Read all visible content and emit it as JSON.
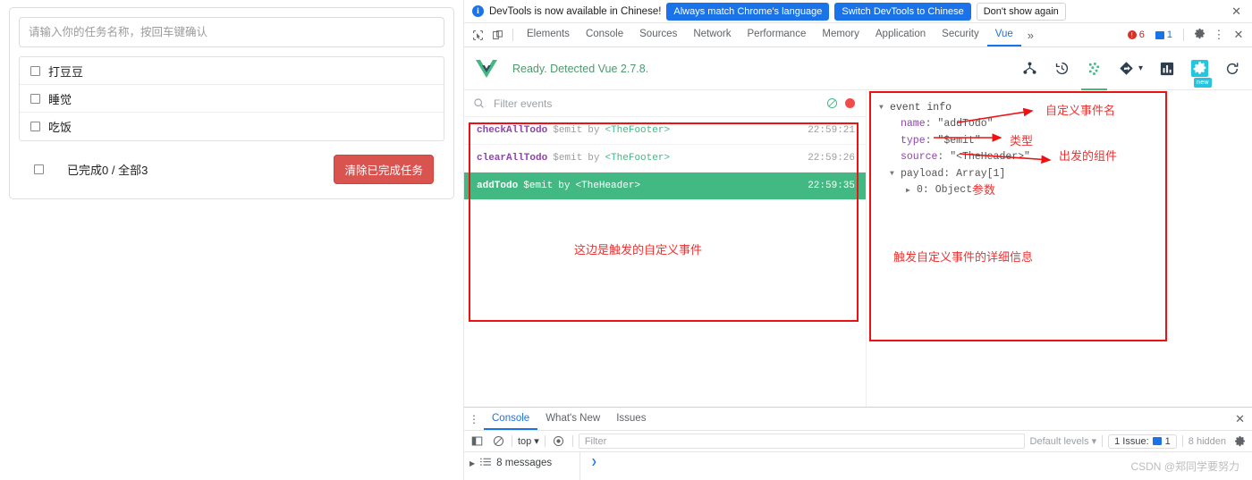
{
  "todo_app": {
    "input_placeholder": "请输入你的任务名称，按回车键确认",
    "input_value": "",
    "items": [
      {
        "label": "打豆豆",
        "checked": false
      },
      {
        "label": "睡觉",
        "checked": false
      },
      {
        "label": "吃饭",
        "checked": false
      }
    ],
    "footer": {
      "summary": "已完成0 / 全部3",
      "clear_button": "清除已完成任务",
      "clear_button_color": "#d9534f"
    }
  },
  "devtools": {
    "banner": {
      "message": "DevTools is now available in Chinese!",
      "primary_button": "Always match Chrome's language",
      "secondary_button": "Switch DevTools to Chinese",
      "tertiary_button": "Don't show again",
      "close": "✕",
      "accent_color": "#1a73e8"
    },
    "tabs": [
      "Elements",
      "Console",
      "Sources",
      "Network",
      "Performance",
      "Memory",
      "Application",
      "Security",
      "Vue"
    ],
    "active_tab": "Vue",
    "more_tabs": "»",
    "status": {
      "errors": "6",
      "messages": "1"
    }
  },
  "vue_panel": {
    "status_text": "Ready. Detected Vue 2.7.8.",
    "status_color": "#4a9a6e",
    "new_chip": "new",
    "toolbar_icons": [
      "component-tree-icon",
      "timeline-icon",
      "events-icon",
      "routes-icon",
      "performance-icon",
      "settings-icon",
      "refresh-icon"
    ],
    "filter_placeholder": "Filter events",
    "filter_value": "",
    "events": [
      {
        "name": "checkAllTodo",
        "type": "$emit",
        "by": "by",
        "source": "<TheFooter>",
        "time": "22:59:21",
        "selected": false
      },
      {
        "name": "clearAllTodo",
        "type": "$emit",
        "by": "by",
        "source": "<TheFooter>",
        "time": "22:59:26",
        "selected": false
      },
      {
        "name": "addTodo",
        "type": "$emit",
        "by": "by",
        "source": "<TheHeader>",
        "time": "22:59:35",
        "selected": true
      }
    ],
    "selected_color": "#42b983",
    "event_info": {
      "header": "event info",
      "rows": [
        {
          "key": "name",
          "value": "\"addTodo\""
        },
        {
          "key": "type",
          "value": "\"$emit\""
        },
        {
          "key": "source",
          "value": "\"<TheHeader>\""
        }
      ],
      "payload_label": "payload: Array[1]",
      "payload_child": "0: Object"
    }
  },
  "annotations": {
    "color": "#ef3333",
    "events_note": "这边是触发的自定义事件",
    "details_note": "触发自定义事件的详细信息",
    "name_note": "自定义事件名",
    "type_note": "类型",
    "source_note": "出发的组件",
    "payload_note": "参数"
  },
  "drawer": {
    "tabs": [
      "Console",
      "What's New",
      "Issues"
    ],
    "active_tab": "Console",
    "close": "✕",
    "context": "top",
    "filter_placeholder": "Filter",
    "filter_value": "",
    "levels": "Default levels",
    "issue_badge": "1 Issue:",
    "issue_count": "1",
    "hidden": "8 hidden",
    "messages_label": "8 messages",
    "prompt": "❯"
  },
  "watermark": "CSDN @郑同学要努力"
}
